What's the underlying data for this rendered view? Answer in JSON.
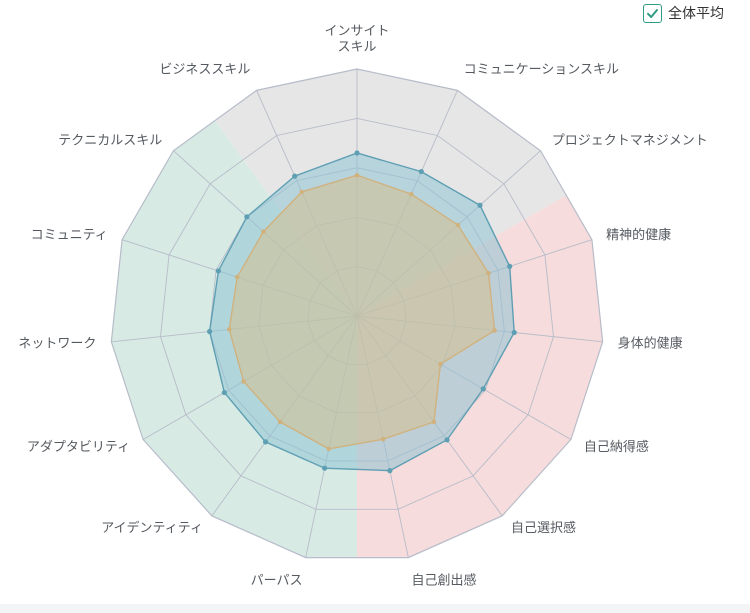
{
  "legend": {
    "label": "全体平均",
    "checked": true,
    "check_icon": "check-icon"
  },
  "colors": {
    "group_skill": "#e6e6e6",
    "group_wellbeing": "#f6dcdc",
    "group_relation": "#d7eae4",
    "grid": "#b7bcc9",
    "series_main_fill": "#8fc3d4",
    "series_main_stroke": "#5e9fb3",
    "series_avg_fill": "#d6c08f",
    "series_avg_stroke": "#d0b27e"
  },
  "chart_data": {
    "type": "radar",
    "categories": [
      "インサイト\nスキル",
      "コミュニケーションスキル",
      "プロジェクトマネジメント",
      "精神的健康",
      "身体的健康",
      "自己納得感",
      "自己選択感",
      "自己創出感",
      "パーパス",
      "アイデンティティ",
      "アダプタビリティ",
      "ネットワーク",
      "コミュニティ",
      "テクニカルスキル",
      "ビジネススキル"
    ],
    "range": [
      0,
      1
    ],
    "series": [
      {
        "values": [
          0.66,
          0.64,
          0.67,
          0.65,
          0.64,
          0.59,
          0.62,
          0.64,
          0.63,
          0.63,
          0.62,
          0.6,
          0.59,
          0.6,
          0.62
        ]
      },
      {
        "name": "全体平均",
        "values": [
          0.57,
          0.54,
          0.55,
          0.56,
          0.56,
          0.39,
          0.53,
          0.51,
          0.55,
          0.53,
          0.53,
          0.52,
          0.51,
          0.51,
          0.55
        ]
      }
    ],
    "groups": [
      {
        "axes": [
          14,
          0,
          1,
          2
        ],
        "color_key": "group_skill"
      },
      {
        "axes": [
          3,
          4,
          5,
          6,
          7
        ],
        "color_key": "group_wellbeing"
      },
      {
        "axes": [
          8,
          9,
          10,
          11,
          12,
          13
        ],
        "color_key": "group_relation"
      }
    ],
    "rings": 5
  }
}
